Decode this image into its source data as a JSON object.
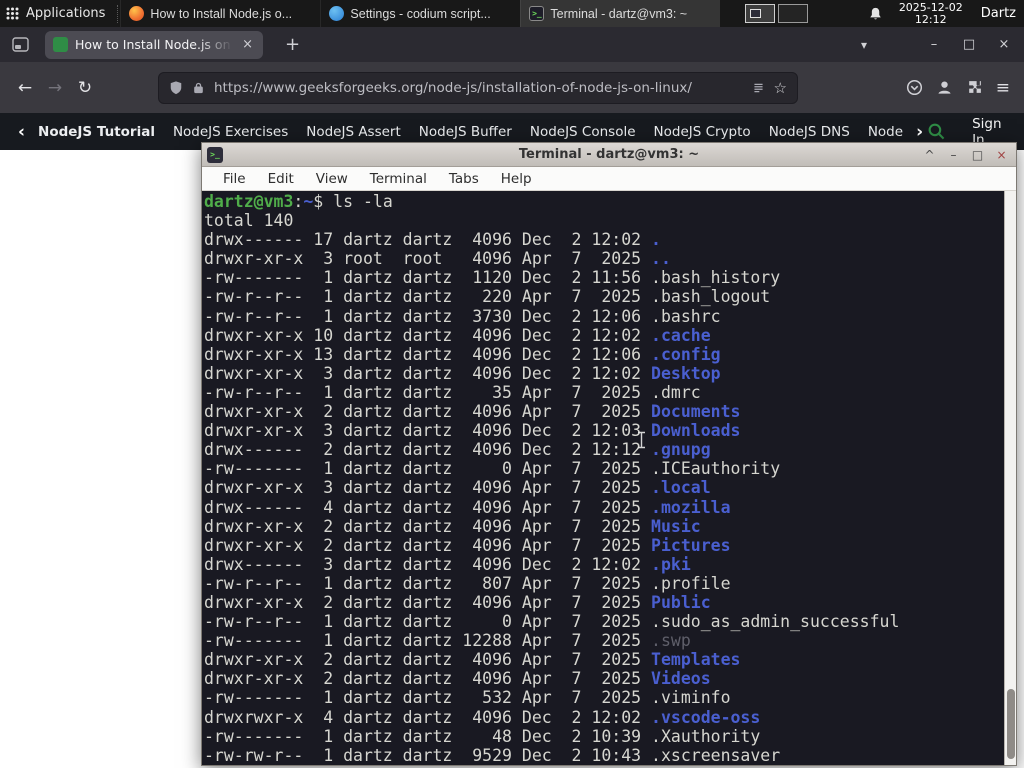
{
  "panel": {
    "applications": "Applications",
    "tasks": [
      {
        "title": "How to Install Node.js o..."
      },
      {
        "title": "Settings - codium script..."
      },
      {
        "title": "Terminal - dartz@vm3: ~"
      }
    ],
    "date": "2025-12-02",
    "time": "12:12",
    "user": "Dartz"
  },
  "browser": {
    "tab_title": "How to Install Node.js on",
    "url": "https://www.geeksforgeeks.org/node-js/installation-of-node-js-on-linux/"
  },
  "gfg": {
    "items": [
      "NodeJS Tutorial",
      "NodeJS Exercises",
      "NodeJS Assert",
      "NodeJS Buffer",
      "NodeJS Console",
      "NodeJS Crypto",
      "NodeJS DNS",
      "Node"
    ],
    "sign_in": "Sign In"
  },
  "terminal": {
    "title": "Terminal - dartz@vm3: ~",
    "menu": [
      "File",
      "Edit",
      "View",
      "Terminal",
      "Tabs",
      "Help"
    ],
    "app_icon_glyph": ">_",
    "prompt": {
      "user": "dartz@vm3",
      "colon": ":",
      "path": "~",
      "dollar": "$",
      "command": "ls -la"
    },
    "total": "total 140",
    "entries": [
      {
        "p": "drwx------",
        "n": "17",
        "o": "dartz",
        "g": "dartz",
        "s": "4096",
        "m": "Dec",
        "d": "2",
        "t": "12:02",
        "name": ".",
        "c": "dir"
      },
      {
        "p": "drwxr-xr-x",
        "n": "3",
        "o": "root",
        "g": "root",
        "s": "4096",
        "m": "Apr",
        "d": "7",
        "t": "2025",
        "name": "..",
        "c": "dir"
      },
      {
        "p": "-rw-------",
        "n": "1",
        "o": "dartz",
        "g": "dartz",
        "s": "1120",
        "m": "Dec",
        "d": "2",
        "t": "11:56",
        "name": ".bash_history",
        "c": ""
      },
      {
        "p": "-rw-r--r--",
        "n": "1",
        "o": "dartz",
        "g": "dartz",
        "s": "220",
        "m": "Apr",
        "d": "7",
        "t": "2025",
        "name": ".bash_logout",
        "c": ""
      },
      {
        "p": "-rw-r--r--",
        "n": "1",
        "o": "dartz",
        "g": "dartz",
        "s": "3730",
        "m": "Dec",
        "d": "2",
        "t": "12:06",
        "name": ".bashrc",
        "c": ""
      },
      {
        "p": "drwxr-xr-x",
        "n": "10",
        "o": "dartz",
        "g": "dartz",
        "s": "4096",
        "m": "Dec",
        "d": "2",
        "t": "12:02",
        "name": ".cache",
        "c": "dir"
      },
      {
        "p": "drwxr-xr-x",
        "n": "13",
        "o": "dartz",
        "g": "dartz",
        "s": "4096",
        "m": "Dec",
        "d": "2",
        "t": "12:06",
        "name": ".config",
        "c": "dir"
      },
      {
        "p": "drwxr-xr-x",
        "n": "3",
        "o": "dartz",
        "g": "dartz",
        "s": "4096",
        "m": "Dec",
        "d": "2",
        "t": "12:02",
        "name": "Desktop",
        "c": "dir"
      },
      {
        "p": "-rw-r--r--",
        "n": "1",
        "o": "dartz",
        "g": "dartz",
        "s": "35",
        "m": "Apr",
        "d": "7",
        "t": "2025",
        "name": ".dmrc",
        "c": ""
      },
      {
        "p": "drwxr-xr-x",
        "n": "2",
        "o": "dartz",
        "g": "dartz",
        "s": "4096",
        "m": "Apr",
        "d": "7",
        "t": "2025",
        "name": "Documents",
        "c": "dir"
      },
      {
        "p": "drwxr-xr-x",
        "n": "3",
        "o": "dartz",
        "g": "dartz",
        "s": "4096",
        "m": "Dec",
        "d": "2",
        "t": "12:03",
        "name": "Downloads",
        "c": "dir"
      },
      {
        "p": "drwx------",
        "n": "2",
        "o": "dartz",
        "g": "dartz",
        "s": "4096",
        "m": "Dec",
        "d": "2",
        "t": "12:12",
        "name": ".gnupg",
        "c": "dir"
      },
      {
        "p": "-rw-------",
        "n": "1",
        "o": "dartz",
        "g": "dartz",
        "s": "0",
        "m": "Apr",
        "d": "7",
        "t": "2025",
        "name": ".ICEauthority",
        "c": ""
      },
      {
        "p": "drwxr-xr-x",
        "n": "3",
        "o": "dartz",
        "g": "dartz",
        "s": "4096",
        "m": "Apr",
        "d": "7",
        "t": "2025",
        "name": ".local",
        "c": "dir"
      },
      {
        "p": "drwx------",
        "n": "4",
        "o": "dartz",
        "g": "dartz",
        "s": "4096",
        "m": "Apr",
        "d": "7",
        "t": "2025",
        "name": ".mozilla",
        "c": "dir"
      },
      {
        "p": "drwxr-xr-x",
        "n": "2",
        "o": "dartz",
        "g": "dartz",
        "s": "4096",
        "m": "Apr",
        "d": "7",
        "t": "2025",
        "name": "Music",
        "c": "dir"
      },
      {
        "p": "drwxr-xr-x",
        "n": "2",
        "o": "dartz",
        "g": "dartz",
        "s": "4096",
        "m": "Apr",
        "d": "7",
        "t": "2025",
        "name": "Pictures",
        "c": "dir"
      },
      {
        "p": "drwx------",
        "n": "3",
        "o": "dartz",
        "g": "dartz",
        "s": "4096",
        "m": "Dec",
        "d": "2",
        "t": "12:02",
        "name": ".pki",
        "c": "dir"
      },
      {
        "p": "-rw-r--r--",
        "n": "1",
        "o": "dartz",
        "g": "dartz",
        "s": "807",
        "m": "Apr",
        "d": "7",
        "t": "2025",
        "name": ".profile",
        "c": ""
      },
      {
        "p": "drwxr-xr-x",
        "n": "2",
        "o": "dartz",
        "g": "dartz",
        "s": "4096",
        "m": "Apr",
        "d": "7",
        "t": "2025",
        "name": "Public",
        "c": "dir"
      },
      {
        "p": "-rw-r--r--",
        "n": "1",
        "o": "dartz",
        "g": "dartz",
        "s": "0",
        "m": "Apr",
        "d": "7",
        "t": "2025",
        "name": ".sudo_as_admin_successful",
        "c": ""
      },
      {
        "p": "-rw-------",
        "n": "1",
        "o": "dartz",
        "g": "dartz",
        "s": "12288",
        "m": "Apr",
        "d": "7",
        "t": "2025",
        "name": ".swp",
        "c": "dim"
      },
      {
        "p": "drwxr-xr-x",
        "n": "2",
        "o": "dartz",
        "g": "dartz",
        "s": "4096",
        "m": "Apr",
        "d": "7",
        "t": "2025",
        "name": "Templates",
        "c": "dir"
      },
      {
        "p": "drwxr-xr-x",
        "n": "2",
        "o": "dartz",
        "g": "dartz",
        "s": "4096",
        "m": "Apr",
        "d": "7",
        "t": "2025",
        "name": "Videos",
        "c": "dir"
      },
      {
        "p": "-rw-------",
        "n": "1",
        "o": "dartz",
        "g": "dartz",
        "s": "532",
        "m": "Apr",
        "d": "7",
        "t": "2025",
        "name": ".viminfo",
        "c": ""
      },
      {
        "p": "drwxrwxr-x",
        "n": "4",
        "o": "dartz",
        "g": "dartz",
        "s": "4096",
        "m": "Dec",
        "d": "2",
        "t": "12:02",
        "name": ".vscode-oss",
        "c": "dir"
      },
      {
        "p": "-rw-------",
        "n": "1",
        "o": "dartz",
        "g": "dartz",
        "s": "48",
        "m": "Dec",
        "d": "2",
        "t": "10:39",
        "name": ".Xauthority",
        "c": ""
      },
      {
        "p": "-rw-rw-r--",
        "n": "1",
        "o": "dartz",
        "g": "dartz",
        "s": "9529",
        "m": "Dec",
        "d": "2",
        "t": "10:43",
        "name": ".xscreensaver",
        "c": ""
      }
    ]
  },
  "glyphs": {
    "back": "←",
    "forward": "→",
    "reload": "↻",
    "star": "☆",
    "menu": "≡",
    "new_tab": "+",
    "tab_list": "▾",
    "tab_close": "×",
    "win_min": "–",
    "win_max": "□",
    "win_close": "×",
    "nav_prev": "‹",
    "nav_next": "›",
    "shade": "^",
    "term_min": "–",
    "term_max": "□",
    "term_close": "×"
  }
}
